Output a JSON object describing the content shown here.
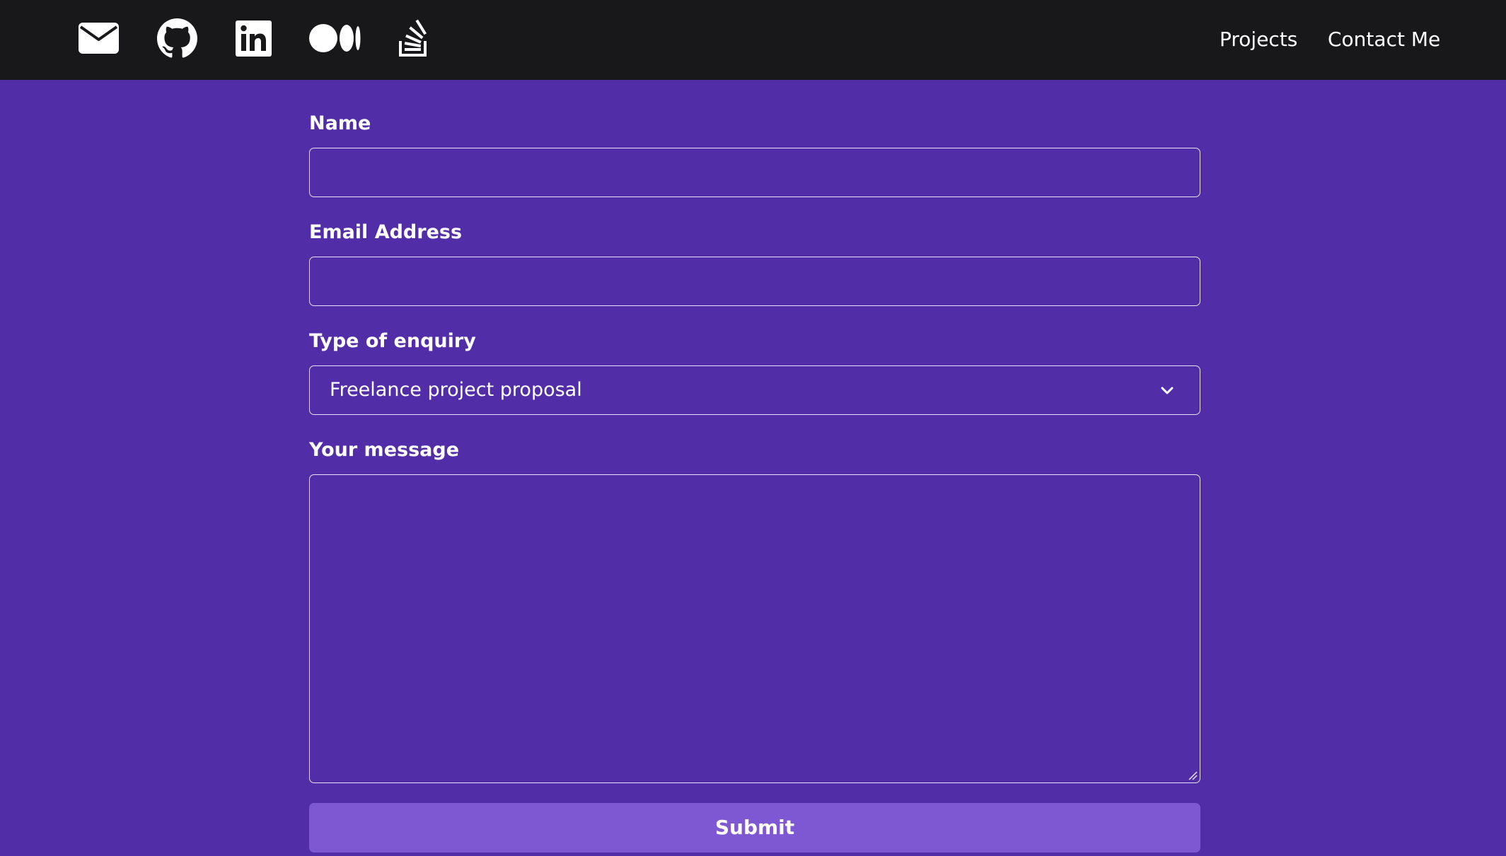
{
  "navbar": {
    "social_links": [
      {
        "icon": "envelope-icon"
      },
      {
        "icon": "github-icon"
      },
      {
        "icon": "linkedin-icon"
      },
      {
        "icon": "medium-icon"
      },
      {
        "icon": "stack-overflow-icon"
      }
    ],
    "links": {
      "projects": "Projects",
      "contact": "Contact Me"
    }
  },
  "form": {
    "name": {
      "label": "Name",
      "value": ""
    },
    "email": {
      "label": "Email Address",
      "value": ""
    },
    "enquiry": {
      "label": "Type of enquiry",
      "selected": "Freelance project proposal"
    },
    "message": {
      "label": "Your message",
      "value": ""
    },
    "submit_label": "Submit"
  },
  "colors": {
    "navbar_bg": "#18181B",
    "page_bg": "#512DA8",
    "button_bg": "#7E57D2",
    "text": "#FFFFFF"
  }
}
